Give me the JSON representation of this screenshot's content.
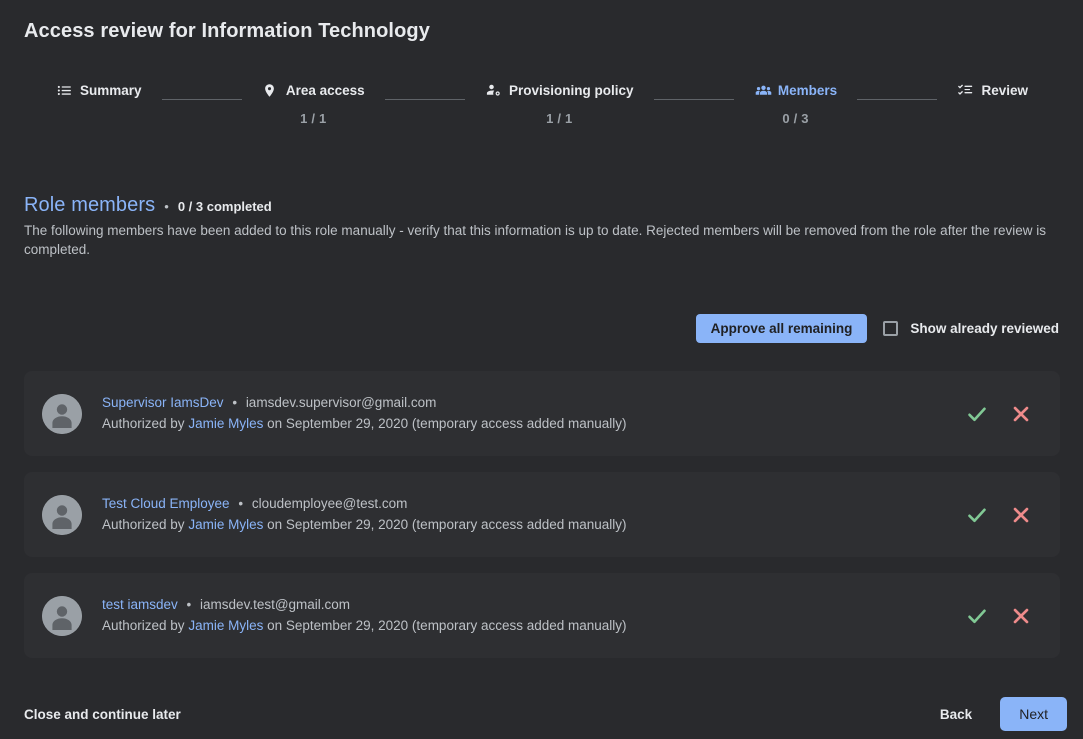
{
  "header": {
    "title": "Access review for Information Technology"
  },
  "stepper": {
    "steps": [
      {
        "label": "Summary",
        "icon": "list-icon",
        "count": "",
        "active": false
      },
      {
        "label": "Area access",
        "icon": "location-pin-icon",
        "count": "1 / 1",
        "active": false
      },
      {
        "label": "Provisioning policy",
        "icon": "manage-accounts-icon",
        "count": "1 / 1",
        "active": false
      },
      {
        "label": "Members",
        "icon": "people-group-icon",
        "count": "0 / 3",
        "active": true
      },
      {
        "label": "Review",
        "icon": "checklist-icon",
        "count": "",
        "active": false
      }
    ]
  },
  "section": {
    "title": "Role members",
    "dot": "•",
    "progress": "0 / 3 completed",
    "description": "The following members have been added to this role manually - verify that this information is up to date. Rejected members will be removed from the role after the review is completed."
  },
  "actions": {
    "approve_all_label": "Approve all remaining",
    "show_reviewed_label": "Show already reviewed",
    "show_reviewed_checked": false
  },
  "members": [
    {
      "avatar_icon": "person-avatar-icon",
      "name": "Supervisor IamsDev",
      "separator": "•",
      "email": "iamsdev.supervisor@gmail.com",
      "auth_prefix": "Authorized by ",
      "authorizer": "Jamie Myles",
      "auth_suffix": " on September 29, 2020 (temporary access added manually)",
      "approve_icon": "check-icon",
      "reject_icon": "close-x-icon"
    },
    {
      "avatar_icon": "person-avatar-icon",
      "name": "Test Cloud Employee",
      "separator": "•",
      "email": "cloudemployee@test.com",
      "auth_prefix": "Authorized by ",
      "authorizer": "Jamie Myles",
      "auth_suffix": " on September 29, 2020 (temporary access added manually)",
      "approve_icon": "check-icon",
      "reject_icon": "close-x-icon"
    },
    {
      "avatar_icon": "person-avatar-icon",
      "name": "test iamsdev",
      "separator": "•",
      "email": "iamsdev.test@gmail.com",
      "auth_prefix": "Authorized by ",
      "authorizer": "Jamie Myles",
      "auth_suffix": " on September 29, 2020 (temporary access added manually)",
      "approve_icon": "check-icon",
      "reject_icon": "close-x-icon"
    }
  ],
  "footer": {
    "close_later_label": "Close and continue later",
    "back_label": "Back",
    "next_label": "Next"
  },
  "colors": {
    "page_background": "#292a2d",
    "card_background": "#2e2f32",
    "accent_blue": "#8ab4f8",
    "text_primary": "#e8eaed",
    "text_secondary": "#bdc1c6",
    "muted": "#9aa0a6",
    "approve_green": "#81c995",
    "reject_red": "#ee8b8b"
  }
}
